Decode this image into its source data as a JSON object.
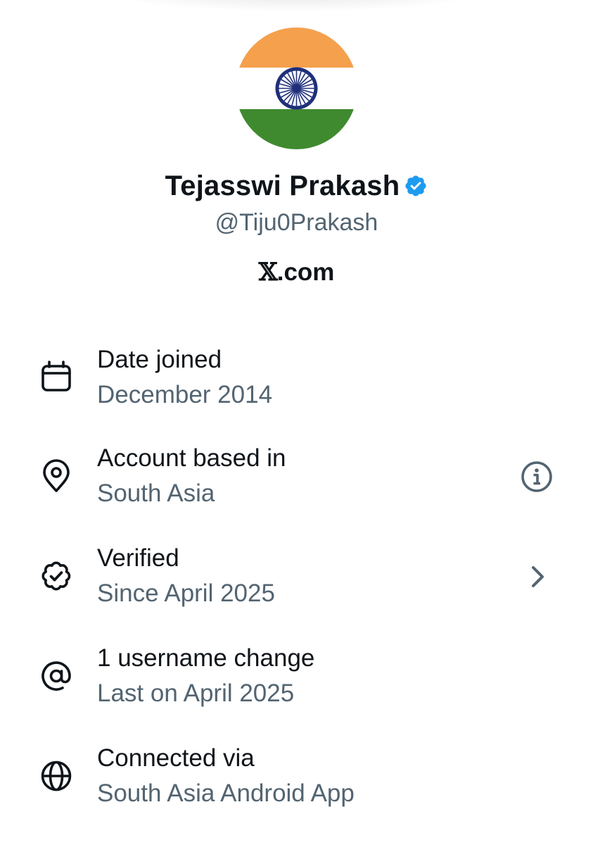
{
  "profile": {
    "name": "Tejasswi Prakash",
    "handle": "@Tiju0Prakash",
    "site_x": "𝕏",
    "site_suffix": ".com"
  },
  "colors": {
    "text_primary": "#0f1419",
    "text_secondary": "#536471",
    "verified_blue": "#1d9bf0",
    "flag_saffron": "#f4a04d",
    "flag_green": "#3f8a2f",
    "chakra_navy": "#1f2f7a"
  },
  "rows": [
    {
      "icon": "calendar-icon",
      "label": "Date joined",
      "value": "December 2014"
    },
    {
      "icon": "location-pin-icon",
      "label": "Account based in",
      "value": "South Asia",
      "action_icon": "info-icon"
    },
    {
      "icon": "verified-badge-outline-icon",
      "label": "Verified",
      "value": "Since April 2025",
      "action_icon": "chevron-right-icon"
    },
    {
      "icon": "at-sign-icon",
      "label": "1 username change",
      "value": "Last on April 2025"
    },
    {
      "icon": "globe-icon",
      "label": "Connected via",
      "value": "South Asia Android App"
    }
  ]
}
